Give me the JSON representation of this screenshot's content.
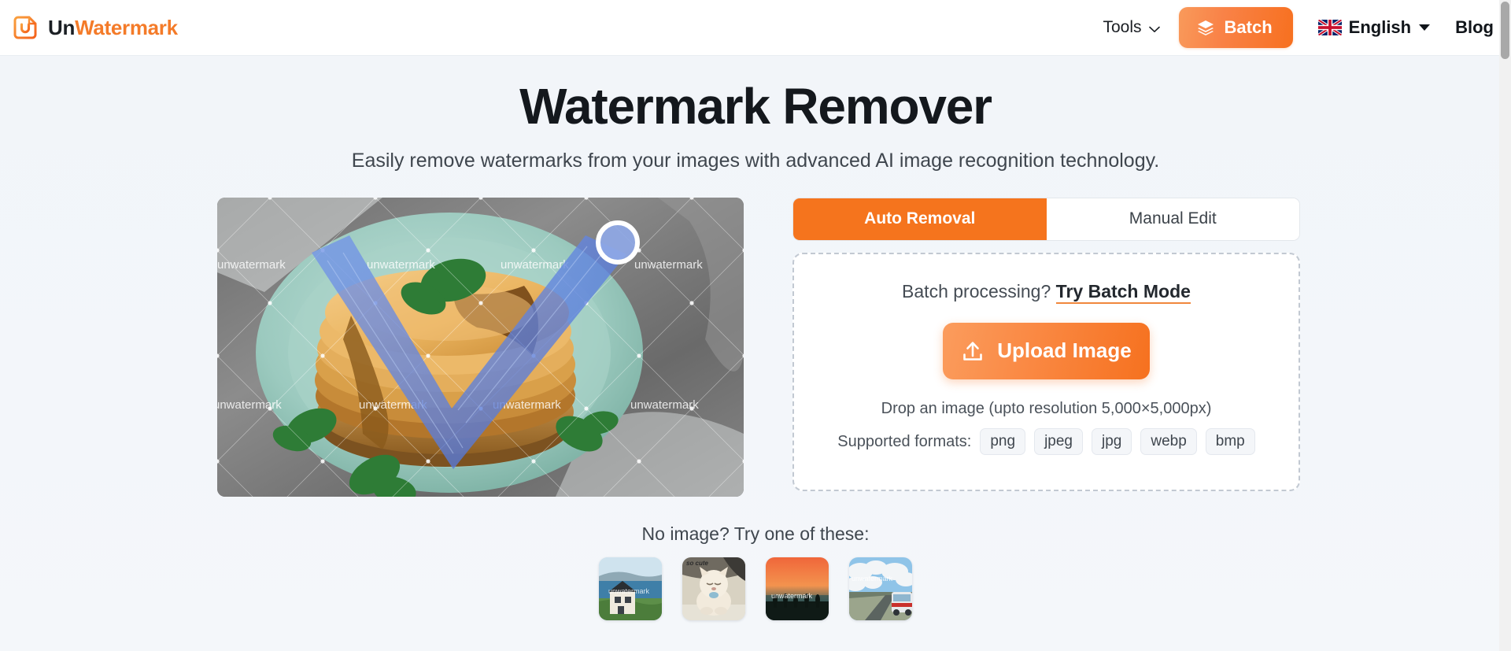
{
  "header": {
    "brand": {
      "prefix": "Un",
      "suffix": "Watermark",
      "logo_icon": "document-u-logo-icon"
    },
    "tools_label": "Tools",
    "tools_chevron_icon": "chevron-down-icon",
    "batch_label": "Batch",
    "batch_icon": "layers-icon",
    "language_label": "English",
    "language_flag_icon": "uk-flag-icon",
    "language_caret_icon": "caret-down-icon",
    "blog_label": "Blog"
  },
  "hero": {
    "title": "Watermark Remover",
    "subtitle": "Easily remove watermarks from your images with advanced AI image recognition technology."
  },
  "preview": {
    "name": "pancake-demo-image",
    "watermark_text": "unwatermark",
    "brush_cursor_icon": "brush-cursor-icon"
  },
  "panel": {
    "tabs": [
      {
        "label": "Auto Removal",
        "active": true
      },
      {
        "label": "Manual Edit",
        "active": false
      }
    ],
    "batch_prompt_text": "Batch processing?",
    "batch_link_label": "Try Batch Mode",
    "upload_label": "Upload Image",
    "upload_icon": "upload-arrow-icon",
    "drop_hint": "Drop an image (upto resolution 5,000×5,000px)",
    "formats_label": "Supported formats:",
    "formats": [
      "png",
      "jpeg",
      "jpg",
      "webp",
      "bmp"
    ]
  },
  "samples": {
    "label": "No image? Try one of these:",
    "items": [
      {
        "name": "sample-house-coast",
        "watermark_text": "unwatermark"
      },
      {
        "name": "sample-cat",
        "watermark_text": "so cute"
      },
      {
        "name": "sample-sunset-silhouette",
        "watermark_text": "unwatermark"
      },
      {
        "name": "sample-bus-clouds",
        "watermark_text": "unwatermark"
      }
    ]
  },
  "colors": {
    "accent_orange": "#f5741d",
    "accent_orange_light": "#fb9c5d",
    "page_bg": "#f2f5f9",
    "text_dark": "#14181d"
  }
}
